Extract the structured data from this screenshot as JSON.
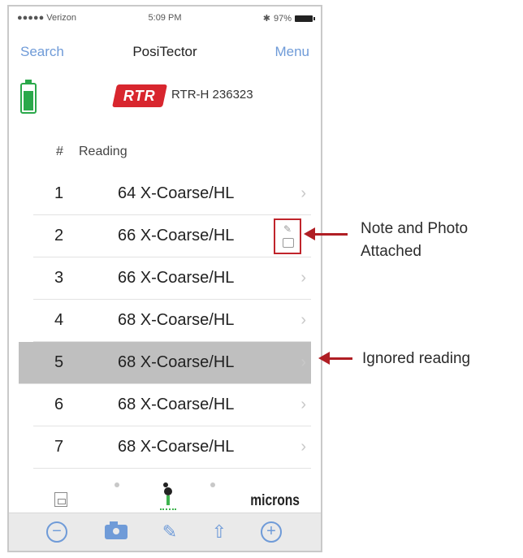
{
  "status_bar": {
    "carrier": "●●●●● Verizon",
    "time": "5:09 PM",
    "battery": "97%"
  },
  "nav": {
    "left": "Search",
    "title": "PosiTector",
    "right": "Menu"
  },
  "device": {
    "logo_text": "RTR",
    "id": "RTR-H 236323"
  },
  "table": {
    "headers": {
      "number": "#",
      "reading": "Reading"
    },
    "rows": [
      {
        "num": "1",
        "value": "64 X-Coarse/HL"
      },
      {
        "num": "2",
        "value": "66 X-Coarse/HL"
      },
      {
        "num": "3",
        "value": "66 X-Coarse/HL"
      },
      {
        "num": "4",
        "value": "68 X-Coarse/HL"
      },
      {
        "num": "5",
        "value": "68 X-Coarse/HL"
      },
      {
        "num": "6",
        "value": "68 X-Coarse/HL"
      },
      {
        "num": "7",
        "value": "68 X-Coarse/HL"
      }
    ]
  },
  "units": "microns",
  "probe_label": "0",
  "callouts": {
    "note_photo": "Note and Photo Attached",
    "ignored": "Ignored reading"
  },
  "colors": {
    "accent": "#6f9bd8",
    "battery": "#2aa84a",
    "logo": "#d8262e",
    "annotation": "#b01e24",
    "ignored_row": "#bfbfbf"
  }
}
